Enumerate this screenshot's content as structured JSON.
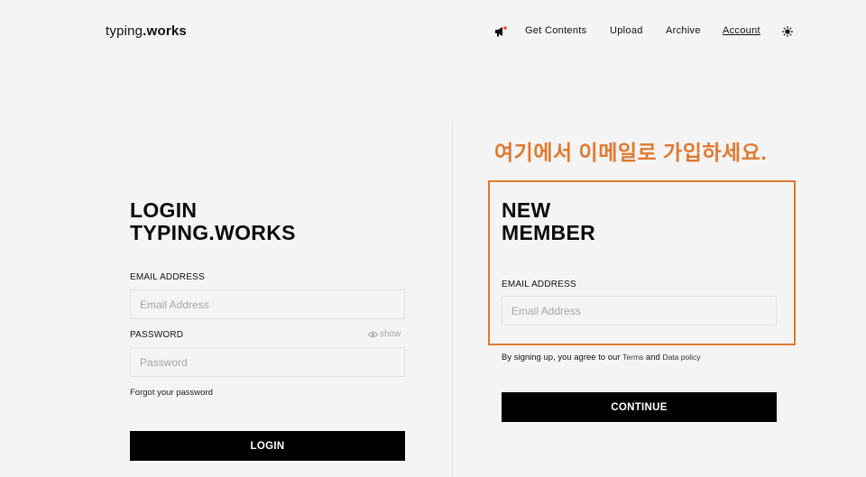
{
  "header": {
    "logo_part1": "typing",
    "logo_part2": ".works",
    "nav": {
      "get_contents": "Get Contents",
      "upload": "Upload",
      "archive": "Archive",
      "account": "Account"
    },
    "icons": {
      "announcement": "megaphone-icon",
      "theme": "sun-icon"
    }
  },
  "login": {
    "title_line1": "LOGIN",
    "title_line2": "TYPING.WORKS",
    "email_label": "EMAIL ADDRESS",
    "email_placeholder": "Email Address",
    "password_label": "PASSWORD",
    "password_placeholder": "Password",
    "show_label": "show",
    "forgot_label": "Forgot your password",
    "login_button": "LOGIN"
  },
  "annotation": {
    "text": "여기에서 이메일로 가입하세요.",
    "color": "#e07930"
  },
  "signup": {
    "title_line1": "NEW",
    "title_line2": "MEMBER",
    "email_label": "EMAIL ADDRESS",
    "email_placeholder": "Email Address",
    "agree_prefix": "By signing up, you agree to our ",
    "terms_link": "Terms",
    "and_text": " and ",
    "data_policy_link": "Data policy",
    "continue_button": "CONTINUE"
  }
}
